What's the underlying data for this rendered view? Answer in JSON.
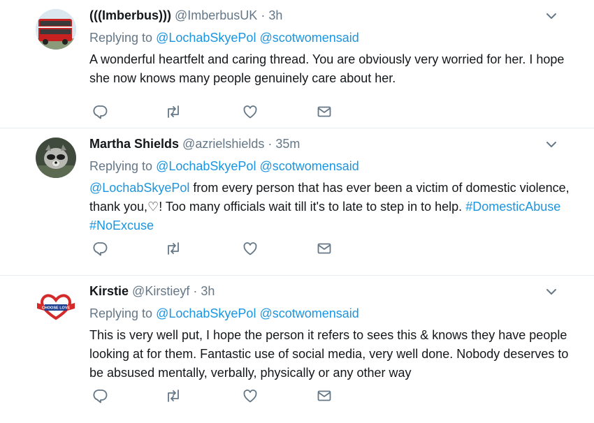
{
  "tweets": [
    {
      "name": "(((Imberbus)))",
      "handle": "@ImberbusUK",
      "sep": "·",
      "time": "3h",
      "reply_prefix": "Replying to",
      "reply_to_1": "@LochabSkyePol",
      "reply_to_2": "@scotwomensaid",
      "text": "A wonderful heartfelt and caring thread. You are obviously very worried for her. I hope she now knows many people genuinely care about her.",
      "avatar": "red-double-decker-bus"
    },
    {
      "name": "Martha Shields",
      "handle": "@azrielshields",
      "sep": "·",
      "time": "35m",
      "reply_prefix": "Replying to",
      "reply_to_1": "@LochabSkyePol",
      "reply_to_2": "@scotwomensaid",
      "mention": "@LochabSkyePol",
      "text_1": " from every person that has ever been a victim of domestic violence, thank you,♡! Too many officials wait till it's to late to step in to help. ",
      "hashtag_1": "#DomesticAbuse",
      "hashtag_2": "#NoExcuse",
      "avatar": "raccoon-photo"
    },
    {
      "name": "Kirstie",
      "handle": "@Kirstieyf",
      "sep": "·",
      "time": "3h",
      "reply_prefix": "Replying to",
      "reply_to_1": "@LochabSkyePol",
      "reply_to_2": "@scotwomensaid",
      "text": "This is very well put, I hope the person it refers to sees this & knows they have people looking at for them. Fantastic use of social media, very well done. Nobody deserves to be absused mentally, verbally, physically or any other way",
      "avatar": "heart-choose-love",
      "avatar_text": "CHOOSE LOVE"
    }
  ],
  "icons": [
    "reply-icon",
    "retweet-icon",
    "like-icon",
    "message-icon",
    "chevron-down-icon"
  ],
  "colors": {
    "link": "#1b95e0",
    "muted": "#657786",
    "text": "#14171a",
    "divider": "#e6ecf0"
  }
}
